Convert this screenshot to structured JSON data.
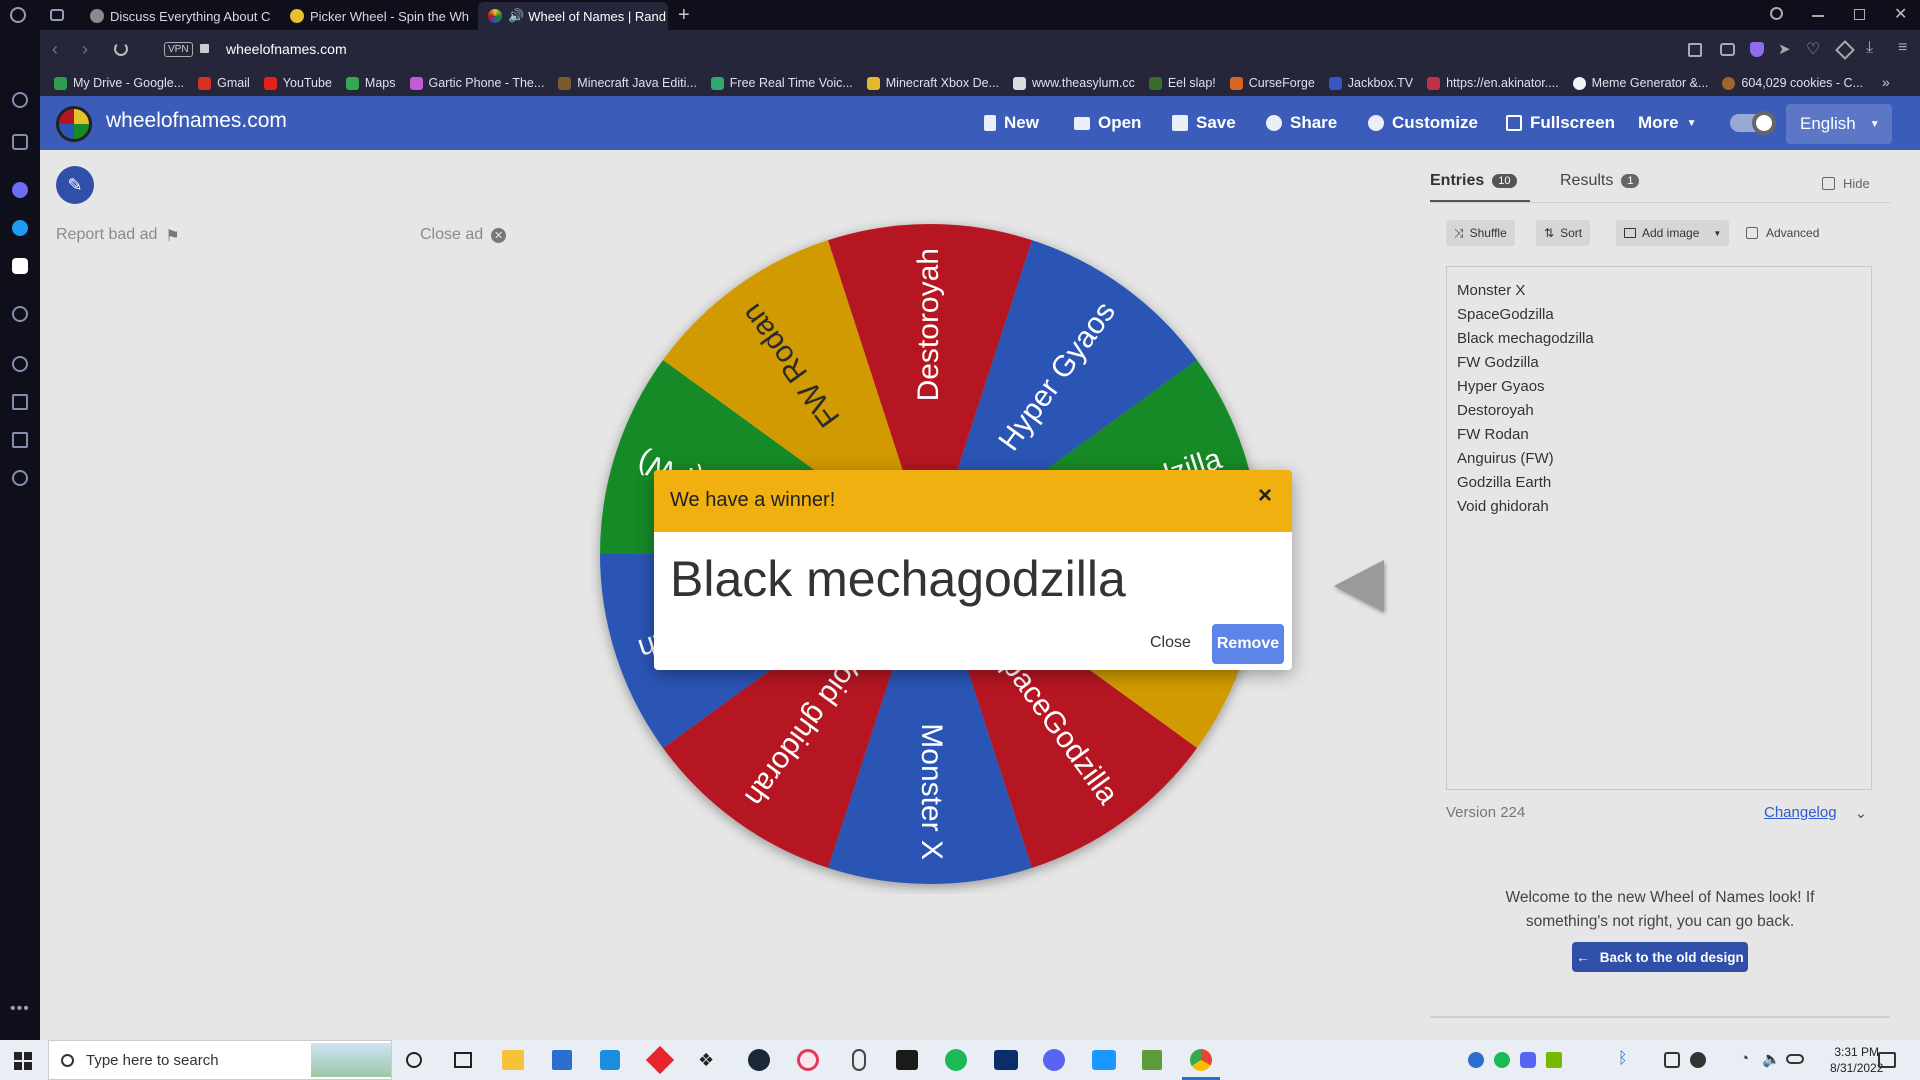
{
  "browser": {
    "tabs": [
      {
        "title": "Discuss Everything About C",
        "favicon_color": "#8a8a8a"
      },
      {
        "title": "Picker Wheel - Spin the Wh",
        "favicon_color": "#e5c02a"
      },
      {
        "title": "Wheel of Names | Rand",
        "favicon_color": "#3b5cb8"
      }
    ],
    "new_tab": "+",
    "url": "wheelofnames.com",
    "vpn": "VPN",
    "bookmarks": [
      {
        "label": "My Drive - Google...",
        "color": "#2f9e4a"
      },
      {
        "label": "Gmail",
        "color": "#d93025"
      },
      {
        "label": "YouTube",
        "color": "#e62117"
      },
      {
        "label": "Maps",
        "color": "#34a853"
      },
      {
        "label": "Gartic Phone - The...",
        "color": "#c15bd6"
      },
      {
        "label": "Minecraft Java Editi...",
        "color": "#7a5a2e"
      },
      {
        "label": "Free Real Time Voic...",
        "color": "#2fa86b"
      },
      {
        "label": "Minecraft Xbox De...",
        "color": "#e2b830"
      },
      {
        "label": "www.theasylum.cc",
        "color": "#dddddd"
      },
      {
        "label": "Eel slap!",
        "color": "#3a6b2a"
      },
      {
        "label": "CurseForge",
        "color": "#d9651f"
      },
      {
        "label": "Jackbox.TV",
        "color": "#3a56c4"
      },
      {
        "label": "https://en.akinator....",
        "color": "#c0304a"
      },
      {
        "label": "Meme Generator &...",
        "color": "#f2f2f2"
      },
      {
        "label": "604,029 cookies - C...",
        "color": "#a0652a"
      }
    ]
  },
  "header": {
    "site_title": "wheelofnames.com",
    "buttons": [
      "New",
      "Open",
      "Save",
      "Share",
      "Customize",
      "Fullscreen",
      "More"
    ],
    "language": "English"
  },
  "ad": {
    "report": "Report bad ad",
    "close": "Close ad"
  },
  "wheel": {
    "segments": [
      {
        "label": "Hyper Gyaos",
        "color": "#2a55b4"
      },
      {
        "label": "FW Godzilla",
        "color": "#178a26"
      },
      {
        "label": "Black mechagodzilla",
        "color": "#d19a06"
      },
      {
        "label": "SpaceGodzilla",
        "color": "#b51523"
      },
      {
        "label": "Monster X",
        "color": "#2a55b4"
      },
      {
        "label": "Void ghidorah",
        "color": "#b51523"
      },
      {
        "label": "Godzilla Earth",
        "color": "#2a55b4"
      },
      {
        "label": "Anguirus (FW)",
        "color": "#178a26"
      },
      {
        "label": "FW Rodan",
        "color": "#d19a06"
      },
      {
        "label": "Destoroyah",
        "color": "#b51523"
      }
    ]
  },
  "panel": {
    "tab_entries": "Entries",
    "entries_count": "10",
    "tab_results": "Results",
    "results_count": "1",
    "hide": "Hide",
    "shuffle": "Shuffle",
    "sort": "Sort",
    "add_image": "Add image",
    "advanced": "Advanced",
    "entries": [
      "Monster X",
      "SpaceGodzilla",
      "Black mechagodzilla",
      "FW Godzilla",
      "Hyper Gyaos",
      "Destoroyah",
      "FW Rodan",
      "Anguirus (FW)",
      "Godzilla Earth",
      "Void ghidorah"
    ],
    "version": "Version 224",
    "changelog": "Changelog",
    "welcome": "Welcome to the new Wheel of Names look! If something's not right, you can go back.",
    "back_button": "Back to the old design"
  },
  "modal": {
    "title": "We have a winner!",
    "winner": "Black mechagodzilla",
    "close": "Close",
    "remove": "Remove",
    "x": "×"
  },
  "taskbar": {
    "search_placeholder": "Type here to search",
    "time": "3:31 PM",
    "date": "8/31/2022"
  }
}
